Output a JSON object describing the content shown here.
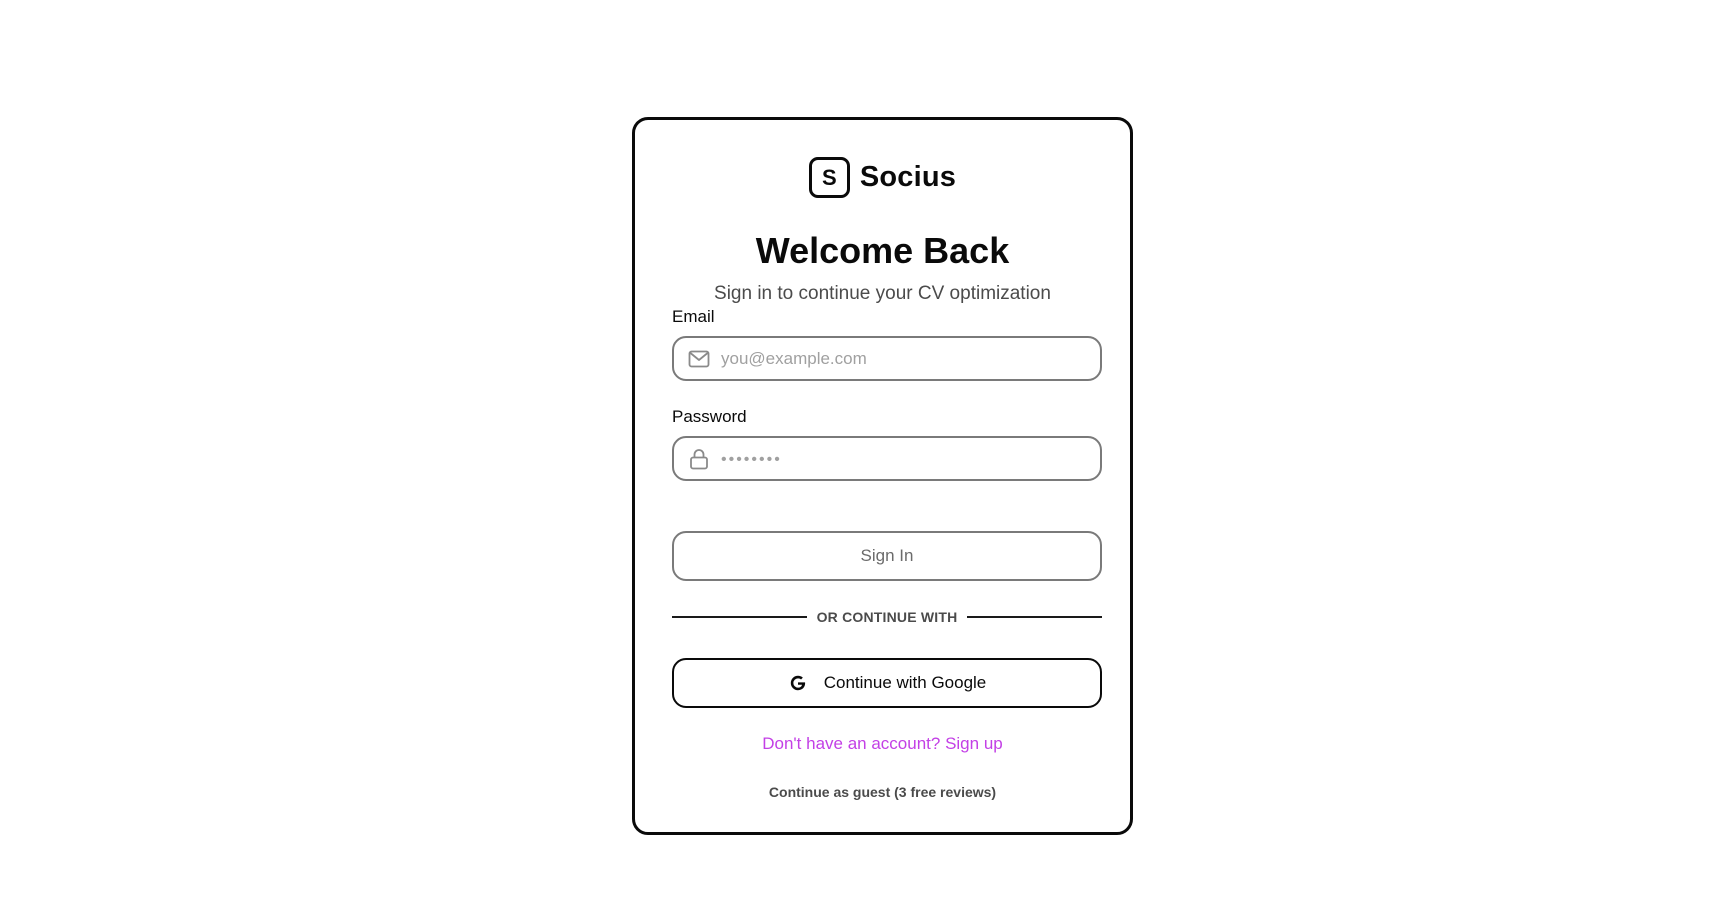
{
  "brand": {
    "logo_letter": "S",
    "name": "Socius"
  },
  "header": {
    "title": "Welcome Back",
    "subtitle": "Sign in to continue your CV optimization"
  },
  "form": {
    "email": {
      "label": "Email",
      "value": "",
      "placeholder": "you@example.com",
      "icon": "mail-icon"
    },
    "password": {
      "label": "Password",
      "value": "",
      "placeholder": "••••••••",
      "icon": "lock-icon"
    },
    "submit_label": "Sign In"
  },
  "divider": {
    "text": "OR CONTINUE WITH"
  },
  "oauth": {
    "google_label": "Continue with Google",
    "icon": "google-icon"
  },
  "links": {
    "signup": "Don't have an account? Sign up",
    "guest": "Continue as guest (3 free reviews)"
  },
  "colors": {
    "accent": "#c340e6",
    "border": "#0a0a0a",
    "input_border": "#7a7a7a",
    "muted_text": "#4b4b4b"
  }
}
